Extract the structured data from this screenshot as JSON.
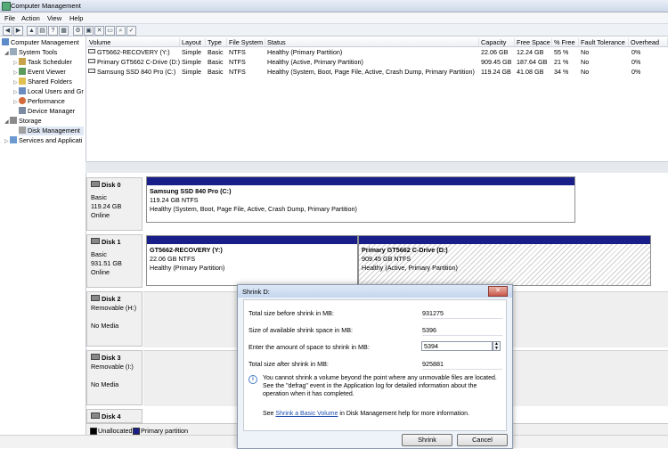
{
  "window": {
    "title": "Computer Management"
  },
  "menu": [
    "File",
    "Action",
    "View",
    "Help"
  ],
  "toolbar_icons": [
    "back-icon",
    "forward-icon",
    "up-icon",
    "properties-icon",
    "help-icon",
    "refresh-icon",
    "settings-icon",
    "connect-icon",
    "delete-icon",
    "open-icon",
    "search-icon",
    "check-icon"
  ],
  "tree": {
    "root": "Computer Management",
    "items": [
      "System Tools",
      "Task Scheduler",
      "Event Viewer",
      "Shared Folders",
      "Local Users and Gr",
      "Performance",
      "Device Manager",
      "Storage",
      "Disk Management",
      "Services and Applicati"
    ]
  },
  "volumes": {
    "columns": [
      "Volume",
      "Layout",
      "Type",
      "File System",
      "Status",
      "Capacity",
      "Free Space",
      "% Free",
      "Fault Tolerance",
      "Overhead"
    ],
    "rows": [
      [
        "GT5662-RECOVERY (Y:)",
        "Simple",
        "Basic",
        "NTFS",
        "Healthy (Primary Partition)",
        "22.06 GB",
        "12.24 GB",
        "55 %",
        "No",
        "0%"
      ],
      [
        "Primary GT5662 C-Drive (D:)",
        "Simple",
        "Basic",
        "NTFS",
        "Healthy (Active, Primary Partition)",
        "909.45 GB",
        "187.64 GB",
        "21 %",
        "No",
        "0%"
      ],
      [
        "Samsung SSD 840 Pro (C:)",
        "Simple",
        "Basic",
        "NTFS",
        "Healthy (System, Boot, Page File, Active, Crash Dump, Primary Partition)",
        "119.24 GB",
        "41.08 GB",
        "34 %",
        "No",
        "0%"
      ]
    ]
  },
  "disks": [
    {
      "name": "Disk 0",
      "type": "Basic",
      "size": "119.24 GB",
      "state": "Online",
      "partitions": [
        {
          "title": "Samsung SSD 840 Pro  (C:)",
          "size": "119.24 GB NTFS",
          "status": "Healthy (System, Boot, Page File, Active, Crash Dump, Primary Partition)"
        }
      ]
    },
    {
      "name": "Disk 1",
      "type": "Basic",
      "size": "931.51 GB",
      "state": "Online",
      "partitions": [
        {
          "title": "GT5662-RECOVERY  (Y:)",
          "size": "22.06 GB NTFS",
          "status": "Healthy (Primary Partition)"
        },
        {
          "title": "Primary GT5662 C-Drive  (D:)",
          "size": "909.45 GB NTFS",
          "status": "Healthy (Active, Primary Partition)"
        }
      ]
    },
    {
      "name": "Disk 2",
      "type": "Removable (H:)",
      "state": "No Media"
    },
    {
      "name": "Disk 3",
      "type": "Removable (I:)",
      "state": "No Media"
    },
    {
      "name": "Disk 4"
    }
  ],
  "legend": {
    "unallocated": "Unallocated",
    "primary": "Primary partition",
    "unallocated_color": "#000000",
    "primary_color": "#1a1e88"
  },
  "dialog": {
    "title": "Shrink D:",
    "fields": [
      {
        "label": "Total size before shrink in MB:",
        "value": "931275"
      },
      {
        "label": "Size of available shrink space in MB:",
        "value": "5396"
      },
      {
        "label": "Enter the amount of space to shrink in MB:",
        "value": "5394"
      },
      {
        "label": "Total size after shrink in MB:",
        "value": "925881"
      }
    ],
    "note": "You cannot shrink a volume beyond the point where any unmovable files are located. See the \"defrag\" event in the Application log for detailed information about the operation when it has completed.",
    "help_prefix": "See",
    "help_link": "Shrink a Basic Volume",
    "help_suffix": "in Disk Management help for more information.",
    "shrink_button": "Shrink",
    "cancel_button": "Cancel"
  }
}
